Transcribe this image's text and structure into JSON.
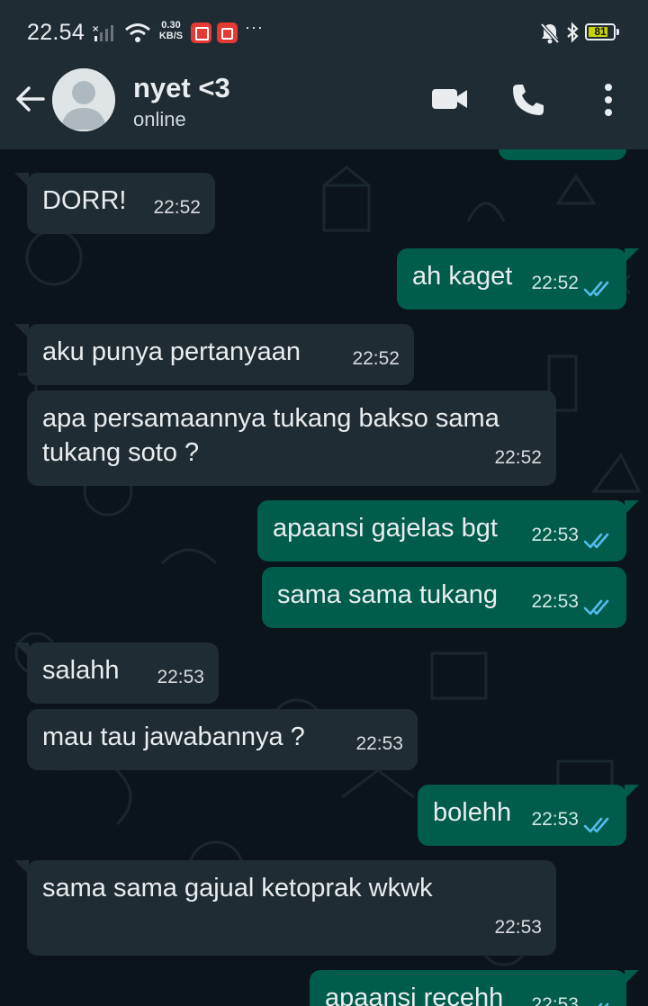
{
  "status_bar": {
    "time": "22.54",
    "speed_value": "0.30",
    "speed_unit": "KB/S",
    "more": "···",
    "battery": "81",
    "battery_level": 0.81,
    "accent_battery": "#c8d400"
  },
  "header": {
    "contact_name": "nyet <3",
    "contact_status": "online",
    "icons": [
      "back-arrow-icon",
      "video-call-icon",
      "phone-icon",
      "more-vert-icon"
    ]
  },
  "colors": {
    "incoming_bubble": "#202c33",
    "outgoing_bubble": "#005c4b",
    "background": "#0b141a",
    "read_ticks": "#53bdeb"
  },
  "messages": [
    {
      "direction": "in",
      "text": "DORR!",
      "time": "22:52"
    },
    {
      "direction": "out",
      "text": "ah kaget",
      "time": "22:52",
      "read": true
    },
    {
      "direction": "in",
      "text": "aku punya pertanyaan",
      "time": "22:52"
    },
    {
      "direction": "in",
      "text": "apa persamaannya tukang bakso sama tukang soto ?",
      "time": "22:52"
    },
    {
      "direction": "out",
      "text": "apaansi gajelas bgt",
      "time": "22:53",
      "read": true
    },
    {
      "direction": "out",
      "text": "sama sama tukang",
      "time": "22:53",
      "read": true
    },
    {
      "direction": "in",
      "text": "salahh",
      "time": "22:53"
    },
    {
      "direction": "in",
      "text": "mau tau jawabannya ?",
      "time": "22:53"
    },
    {
      "direction": "out",
      "text": "bolehh",
      "time": "22:53",
      "read": true
    },
    {
      "direction": "in",
      "text": "sama sama gajual ketoprak wkwk",
      "time": "22:53"
    },
    {
      "direction": "out",
      "text": "apaansi recehh",
      "time": "22:53",
      "read": true
    }
  ]
}
